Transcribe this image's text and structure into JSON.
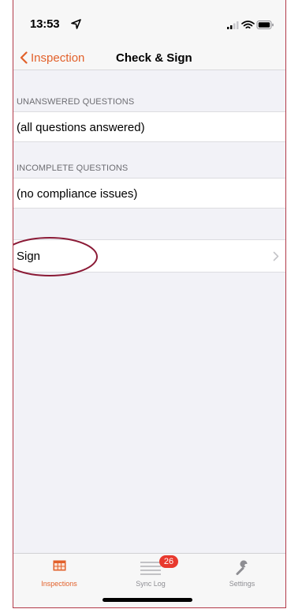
{
  "status_bar": {
    "time": "13:53"
  },
  "nav": {
    "back_label": "Inspection",
    "title": "Check & Sign"
  },
  "sections": {
    "unanswered": {
      "header": "UNANSWERED QUESTIONS",
      "value": "(all questions answered)"
    },
    "incomplete": {
      "header": "INCOMPLETE QUESTIONS",
      "value": "(no compliance issues)"
    },
    "sign": {
      "label": "Sign"
    }
  },
  "tabs": [
    {
      "label": "Inspections",
      "icon": "inspections-grid-icon",
      "active": true
    },
    {
      "label": "Sync Log",
      "icon": "list-icon",
      "badge": "26",
      "active": false
    },
    {
      "label": "Settings",
      "icon": "wrench-icon",
      "active": false
    }
  ],
  "colors": {
    "accent": "#e2612b",
    "annotation": "#8b1a36",
    "badge": "#e8392e"
  }
}
